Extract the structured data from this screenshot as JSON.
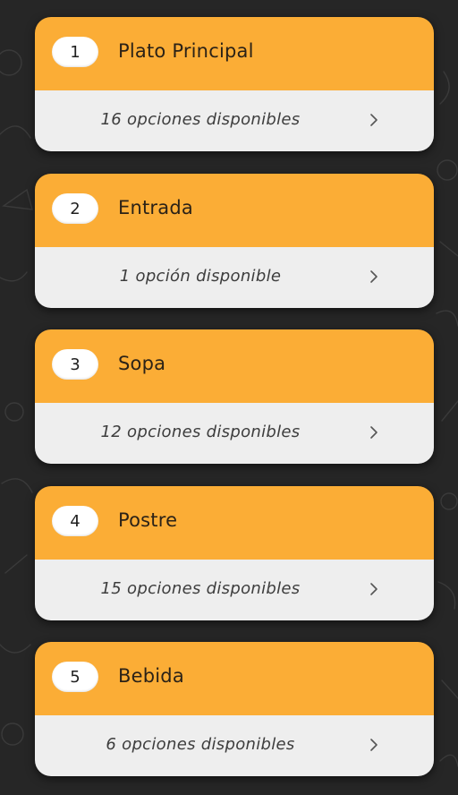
{
  "categories": [
    {
      "number": "1",
      "title": "Plato Principal",
      "options": "16 opciones disponibles"
    },
    {
      "number": "2",
      "title": "Entrada",
      "options": "1 opción disponible"
    },
    {
      "number": "3",
      "title": "Sopa",
      "options": "12 opciones disponibles"
    },
    {
      "number": "4",
      "title": "Postre",
      "options": "15 opciones disponibles"
    },
    {
      "number": "5",
      "title": "Bebida",
      "options": "6 opciones disponibles"
    }
  ],
  "colors": {
    "header": "#FBAD36",
    "body": "#EEEEEE",
    "background": "#262626",
    "badge": "#FFFFFF"
  },
  "icons": {
    "chevron": "chevron-right-icon"
  }
}
